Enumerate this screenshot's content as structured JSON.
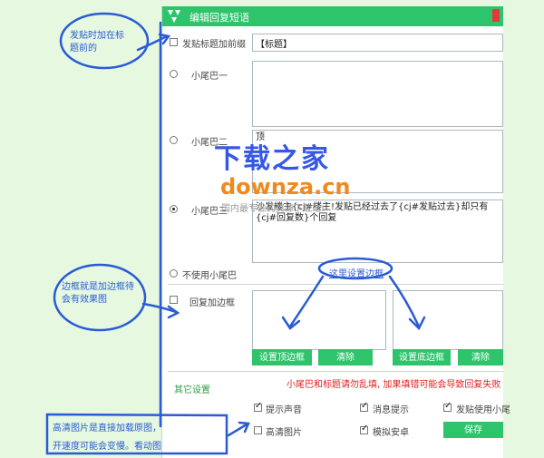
{
  "window": {
    "title": "编辑回复短语"
  },
  "prefix": {
    "label": "发贴标题加前缀",
    "value": "【标题】"
  },
  "tails": {
    "option1": {
      "label": "小尾巴一",
      "value": ""
    },
    "option2": {
      "label": "小尾巴二",
      "value": "顶"
    },
    "option3": {
      "label": "小尾巴三",
      "value": "沙发楼主{cj#楼主!发贴已经过去了{cj#发贴过去}却只有{cj#回复数}个回复"
    },
    "none": {
      "label": "不使用小尾巴"
    }
  },
  "border": {
    "label": "回复加边框",
    "set_link": "这里设置边框",
    "set_top": "设置顶边框",
    "clear1": "清除",
    "set_bottom": "设置底边框",
    "clear2": "清除"
  },
  "other": {
    "title": "其它设置",
    "warning": "小尾巴和标题请勿乱填, 加果填错可能会导致回复失败",
    "opt_sound": "提示声音",
    "opt_msg": "消息提示",
    "opt_post": "发贴使用小尾",
    "opt_hd": "高清图片",
    "opt_sim": "模拟安卓",
    "save": "保存"
  },
  "annotations": {
    "a1_l1": "发贴时加在标",
    "a1_l2": "题前的",
    "a2_l1": "边框就是加边框待",
    "a2_l2": "会有效果图",
    "a3_l1": "高清图片是直接加载原图，不过页面打",
    "a3_l2": "开速度可能会变慢。看动图时建议开启"
  },
  "watermark": {
    "brand_cn": "下载之家",
    "brand_en": "downza.cn",
    "slogan": "国内最专业的资源下载站!"
  },
  "colors": {
    "accent": "#2ec46b",
    "annotation": "#2a5bd6",
    "warning": "#e02020",
    "page_bg": "#e6f8df"
  }
}
